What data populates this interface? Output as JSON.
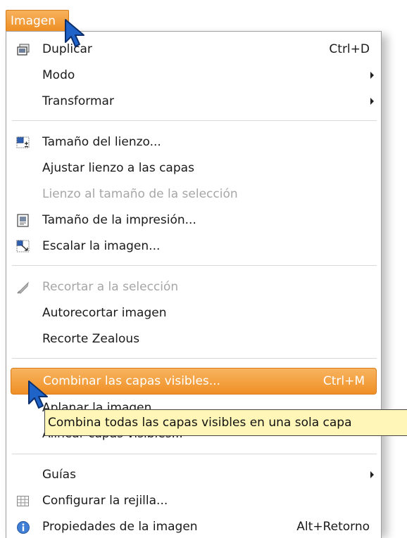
{
  "menubar": {
    "label": "Imagen"
  },
  "menu": {
    "items": [
      {
        "label": "Duplicar",
        "shortcut": "Ctrl+D",
        "icon": "duplicate-icon"
      },
      {
        "label": "Modo",
        "submenu": true
      },
      {
        "label": "Transformar",
        "submenu": true
      },
      {
        "label": "Tamaño del lienzo...",
        "icon": "canvas-size-icon"
      },
      {
        "label": "Ajustar lienzo a las capas"
      },
      {
        "label": "Lienzo al tamaño de la selección",
        "disabled": true
      },
      {
        "label": "Tamaño de la impresión...",
        "icon": "print-size-icon"
      },
      {
        "label": "Escalar la imagen...",
        "icon": "scale-image-icon"
      },
      {
        "label": "Recortar a la selección",
        "disabled": true,
        "icon": "crop-icon"
      },
      {
        "label": "Autorecortar imagen"
      },
      {
        "label": "Recorte Zealous"
      },
      {
        "label": "Combinar las capas visibles...",
        "shortcut": "Ctrl+M",
        "highlighted": true
      },
      {
        "label": "Aplanar la imagen"
      },
      {
        "label": "Alinear capas visibles..."
      },
      {
        "label": "Guías",
        "submenu": true
      },
      {
        "label": "Configurar la rejilla...",
        "icon": "grid-icon"
      },
      {
        "label": "Propiedades de la imagen",
        "shortcut": "Alt+Retorno",
        "icon": "info-icon"
      }
    ]
  },
  "tooltip": {
    "text": "Combina todas las capas visibles en una sola capa"
  },
  "colors": {
    "highlight": "#ef9026",
    "tooltip_bg": "#fff6b8",
    "cursor": "#1f63c9"
  }
}
